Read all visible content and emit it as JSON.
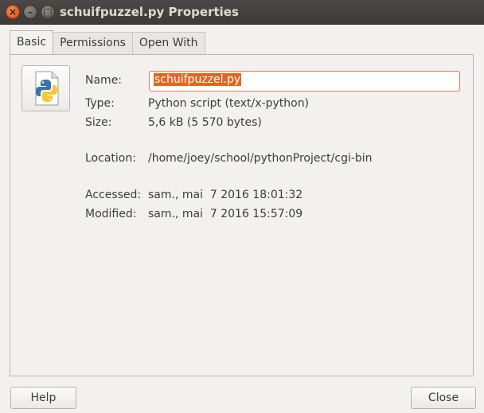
{
  "window": {
    "title": "schuifpuzzel.py Properties",
    "close_glyph": "×",
    "minimize_glyph": "–",
    "maximize_glyph": "□"
  },
  "tabs": [
    {
      "label": "Basic",
      "active": true
    },
    {
      "label": "Permissions",
      "active": false
    },
    {
      "label": "Open With",
      "active": false
    }
  ],
  "basic": {
    "file_icon": "python-file-icon",
    "name_label": "Name:",
    "name_value": "schuifpuzzel.py",
    "type_label": "Type:",
    "type_value": "Python script (text/x-python)",
    "size_label": "Size:",
    "size_value": "5,6 kB (5 570 bytes)",
    "location_label": "Location:",
    "location_value": "/home/joey/school/pythonProject/cgi-bin",
    "accessed_label": "Accessed:",
    "accessed_value": "sam., mai  7 2016 18:01:32",
    "modified_label": "Modified:",
    "modified_value": "sam., mai  7 2016 15:57:09"
  },
  "buttons": {
    "help": "Help",
    "close": "Close"
  },
  "colors": {
    "accent": "#e2661f",
    "titlebar": "#3c3b37",
    "window_bg": "#f2f1f0"
  }
}
